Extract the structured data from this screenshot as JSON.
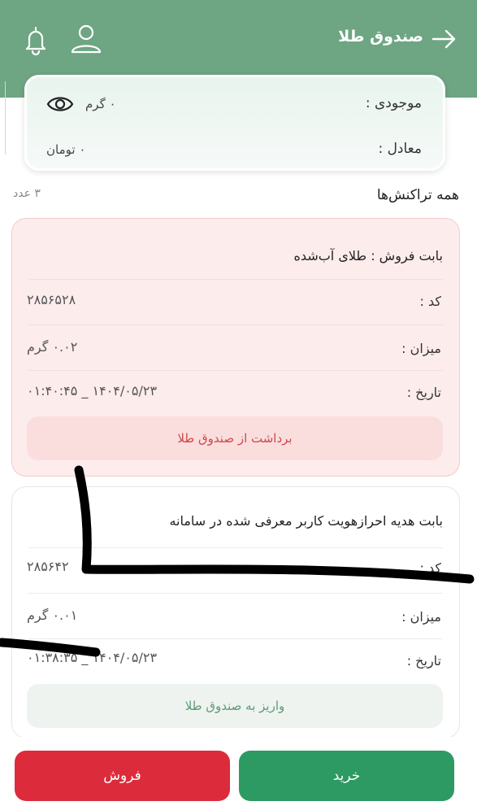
{
  "header": {
    "title": "صندوق طلا",
    "icons": {
      "back": "arrow-right-icon",
      "bell": "bell-icon",
      "user": "user-icon"
    }
  },
  "balance": {
    "stock_label": "موجودی :",
    "stock_value": "۰ گرم",
    "equiv_label": "معادل :",
    "equiv_value": "۰ تومان"
  },
  "list": {
    "title": "همه تراکنش‌ها",
    "count": "۳ عدد"
  },
  "transactions": [
    {
      "title": "بابت فروش : طلای آب‌شده",
      "code_label": "کد :",
      "code": "۲۸۵۶۵۲۸",
      "amount_label": "میزان :",
      "amount": "۰.۰۲ گرم",
      "date_label": "تاریخ :",
      "date": "۱۴۰۴/۰۵/۲۳ _ ۰۱:۴۰:۴۵",
      "status": "برداشت از صندوق طلا"
    },
    {
      "title": "بابت هدیه احرازهویت کاربر معرفی شده در سامانه",
      "code_label": "کد :",
      "code": "۲۸۵۶۴۲",
      "amount_label": "میزان :",
      "amount": "۰.۰۱ گرم",
      "date_label": "تاریخ :",
      "date": "۱۴۰۴/۰۵/۲۳ _ ۰۱:۳۸:۳۵",
      "status": "واریز به صندوق طلا"
    }
  ],
  "actions": {
    "buy": "خرید",
    "sell": "فروش"
  },
  "colors": {
    "header": "#6ea583",
    "buy": "#2e9a63",
    "sell": "#dc2b3a",
    "withdraw_text": "#d04848",
    "deposit_text": "#5d9a76"
  }
}
